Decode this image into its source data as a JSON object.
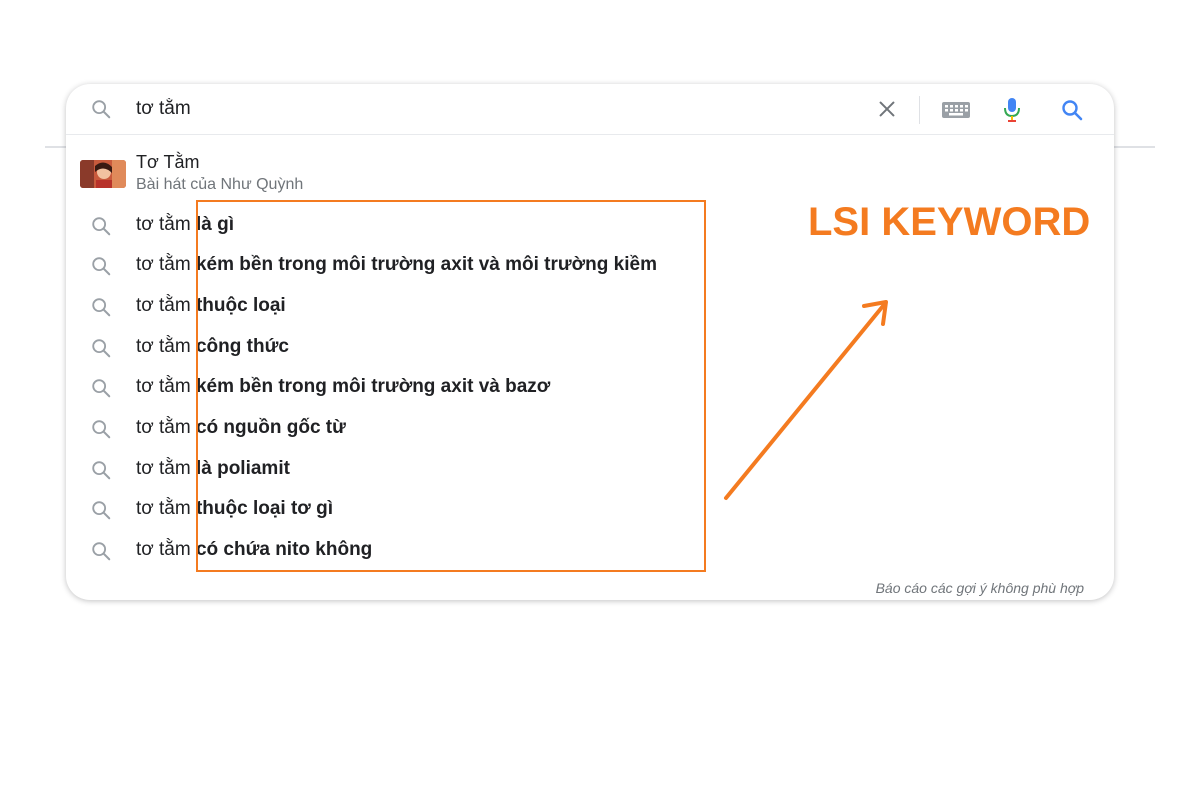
{
  "search": {
    "query": "tơ tằm"
  },
  "icons": {
    "search": "search-icon",
    "clear": "close-icon",
    "keyboard": "keyboard-icon",
    "mic": "microphone-icon",
    "go": "search-icon"
  },
  "entity": {
    "title": "Tơ Tằm",
    "subtitle": "Bài hát của Như Quỳnh"
  },
  "suggestions": [
    {
      "prefix": "tơ tằm ",
      "completion": "là gì"
    },
    {
      "prefix": "tơ tằm ",
      "completion": "kém bền trong môi trường axit và môi trường kiềm"
    },
    {
      "prefix": "tơ tằm ",
      "completion": "thuộc loại"
    },
    {
      "prefix": "tơ tằm ",
      "completion": "công thức"
    },
    {
      "prefix": "tơ tằm ",
      "completion": "kém bền trong môi trường axit và bazơ"
    },
    {
      "prefix": "tơ tằm ",
      "completion": "có nguồn gốc từ"
    },
    {
      "prefix": "tơ tằm ",
      "completion": "là poliamit"
    },
    {
      "prefix": "tơ tằm ",
      "completion": "thuộc loại tơ gì"
    },
    {
      "prefix": "tơ tằm ",
      "completion": "có chứa nito không"
    }
  ],
  "report_link": "Báo cáo các gợi ý không phù hợp",
  "annotation": {
    "label": "LSI KEYWORD",
    "color": "#f47b20"
  },
  "colors": {
    "google_blue": "#4285f4",
    "google_red": "#ea4335",
    "text": "#202124",
    "muted": "#70757a"
  }
}
